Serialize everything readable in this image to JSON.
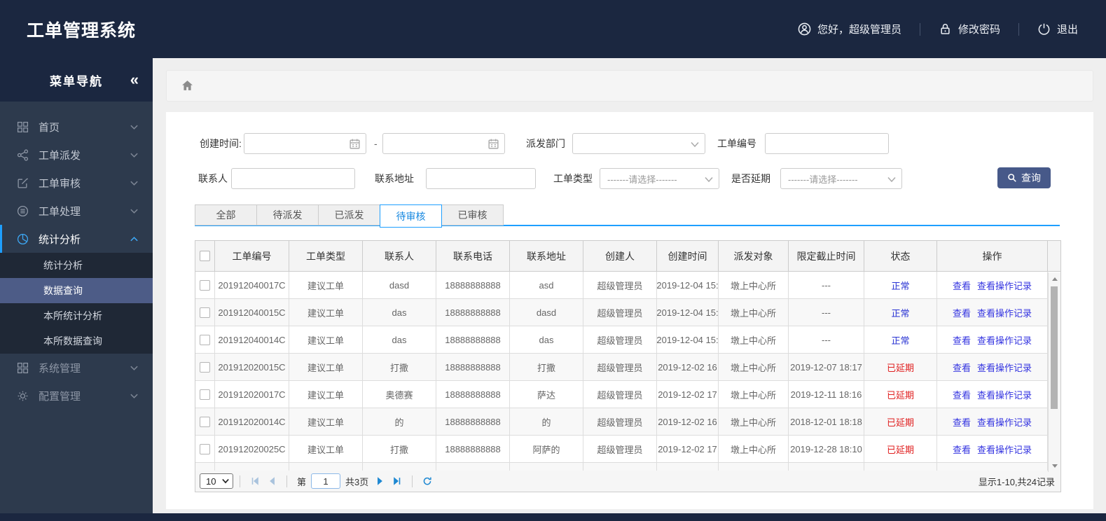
{
  "header": {
    "title": "工单管理系统",
    "greeting": "您好，超级管理员",
    "change_password": "修改密码",
    "logout": "退出"
  },
  "sidebar": {
    "nav_title": "菜单导航",
    "collapse_glyph": "«",
    "items": [
      {
        "label": "首页",
        "icon": "grid-icon"
      },
      {
        "label": "工单派发",
        "icon": "share-icon"
      },
      {
        "label": "工单审核",
        "icon": "edit-icon"
      },
      {
        "label": "工单处理",
        "icon": "process-icon"
      },
      {
        "label": "统计分析",
        "icon": "pie-chart-icon",
        "active": true,
        "expanded": true
      },
      {
        "label": "系统管理",
        "icon": "apps-icon"
      },
      {
        "label": "配置管理",
        "icon": "gear-icon"
      }
    ],
    "submenu": [
      {
        "label": "统计分析"
      },
      {
        "label": "数据查询",
        "selected": true
      },
      {
        "label": "本所统计分析"
      },
      {
        "label": "本所数据查询"
      }
    ]
  },
  "filters": {
    "create_time_label": "创建时间:",
    "dash": "-",
    "dispatch_dept_label": "派发部门",
    "order_no_label": "工单编号",
    "contact_label": "联系人",
    "contact_addr_label": "联系地址",
    "order_type_label": "工单类型",
    "overdue_label": "是否延期",
    "select_placeholder": "-------请选择-------",
    "search_button": "查询"
  },
  "tabs": [
    {
      "label": "全部"
    },
    {
      "label": "待派发"
    },
    {
      "label": "已派发"
    },
    {
      "label": "待审核",
      "active": true
    },
    {
      "label": "已审核"
    }
  ],
  "table": {
    "columns": [
      "工单编号",
      "工单类型",
      "联系人",
      "联系电话",
      "联系地址",
      "创建人",
      "创建时间",
      "派发对象",
      "限定截止时间",
      "状态",
      "操作"
    ],
    "action_labels": [
      "查看",
      "查看操作记录"
    ],
    "rows": [
      {
        "order_no": "201912040017C",
        "order_type": "建议工单",
        "contact": "dasd",
        "phone": "18888888888",
        "address": "asd",
        "creator": "超级管理员",
        "create_time": "2019-12-04 15:",
        "dispatch_target": "墩上中心所",
        "deadline": "---",
        "status": "正常",
        "status_type": "normal"
      },
      {
        "order_no": "201912040015C",
        "order_type": "建议工单",
        "contact": "das",
        "phone": "18888888888",
        "address": "dasd",
        "creator": "超级管理员",
        "create_time": "2019-12-04 15:",
        "dispatch_target": "墩上中心所",
        "deadline": "---",
        "status": "正常",
        "status_type": "normal"
      },
      {
        "order_no": "201912040014C",
        "order_type": "建议工单",
        "contact": "das",
        "phone": "18888888888",
        "address": "das",
        "creator": "超级管理员",
        "create_time": "2019-12-04 15:",
        "dispatch_target": "墩上中心所",
        "deadline": "---",
        "status": "正常",
        "status_type": "normal"
      },
      {
        "order_no": "201912020015C",
        "order_type": "建议工单",
        "contact": "打撒",
        "phone": "18888888888",
        "address": "打撒",
        "creator": "超级管理员",
        "create_time": "2019-12-02 16",
        "dispatch_target": "墩上中心所",
        "deadline": "2019-12-07 18:17",
        "status": "已延期",
        "status_type": "delayed"
      },
      {
        "order_no": "201912020017C",
        "order_type": "建议工单",
        "contact": "奥德赛",
        "phone": "18888888888",
        "address": "萨达",
        "creator": "超级管理员",
        "create_time": "2019-12-02 17",
        "dispatch_target": "墩上中心所",
        "deadline": "2019-12-11 18:16",
        "status": "已延期",
        "status_type": "delayed"
      },
      {
        "order_no": "201912020014C",
        "order_type": "建议工单",
        "contact": "的",
        "phone": "18888888888",
        "address": "的",
        "creator": "超级管理员",
        "create_time": "2019-12-02 16",
        "dispatch_target": "墩上中心所",
        "deadline": "2018-12-01 18:18",
        "status": "已延期",
        "status_type": "delayed"
      },
      {
        "order_no": "201912020025C",
        "order_type": "建议工单",
        "contact": "打撒",
        "phone": "18888888888",
        "address": "阿萨的",
        "creator": "超级管理员",
        "create_time": "2019-12-02 17",
        "dispatch_target": "墩上中心所",
        "deadline": "2019-12-28 18:10",
        "status": "已延期",
        "status_type": "delayed"
      },
      {
        "order_no": "",
        "order_type": "",
        "contact": "",
        "phone": "",
        "address": "",
        "creator": "",
        "create_time": "",
        "dispatch_target": "",
        "deadline": "",
        "status": "",
        "status_type": ""
      }
    ]
  },
  "pagination": {
    "page_size": "10",
    "page_prefix": "第",
    "current_page": "1",
    "total_pages": "共3页",
    "summary": "显示1-10,共24记录"
  },
  "colors": {
    "header_bg": "#1b2740",
    "sidebar_bg": "#2d3a4d",
    "submenu_selected_bg": "#4d5c87",
    "accent_blue": "#1e9fff",
    "primary_button_bg": "#475989",
    "link_blue": "#3333e0",
    "status_normal": "#2832d3",
    "status_delayed": "#e01f1f"
  }
}
